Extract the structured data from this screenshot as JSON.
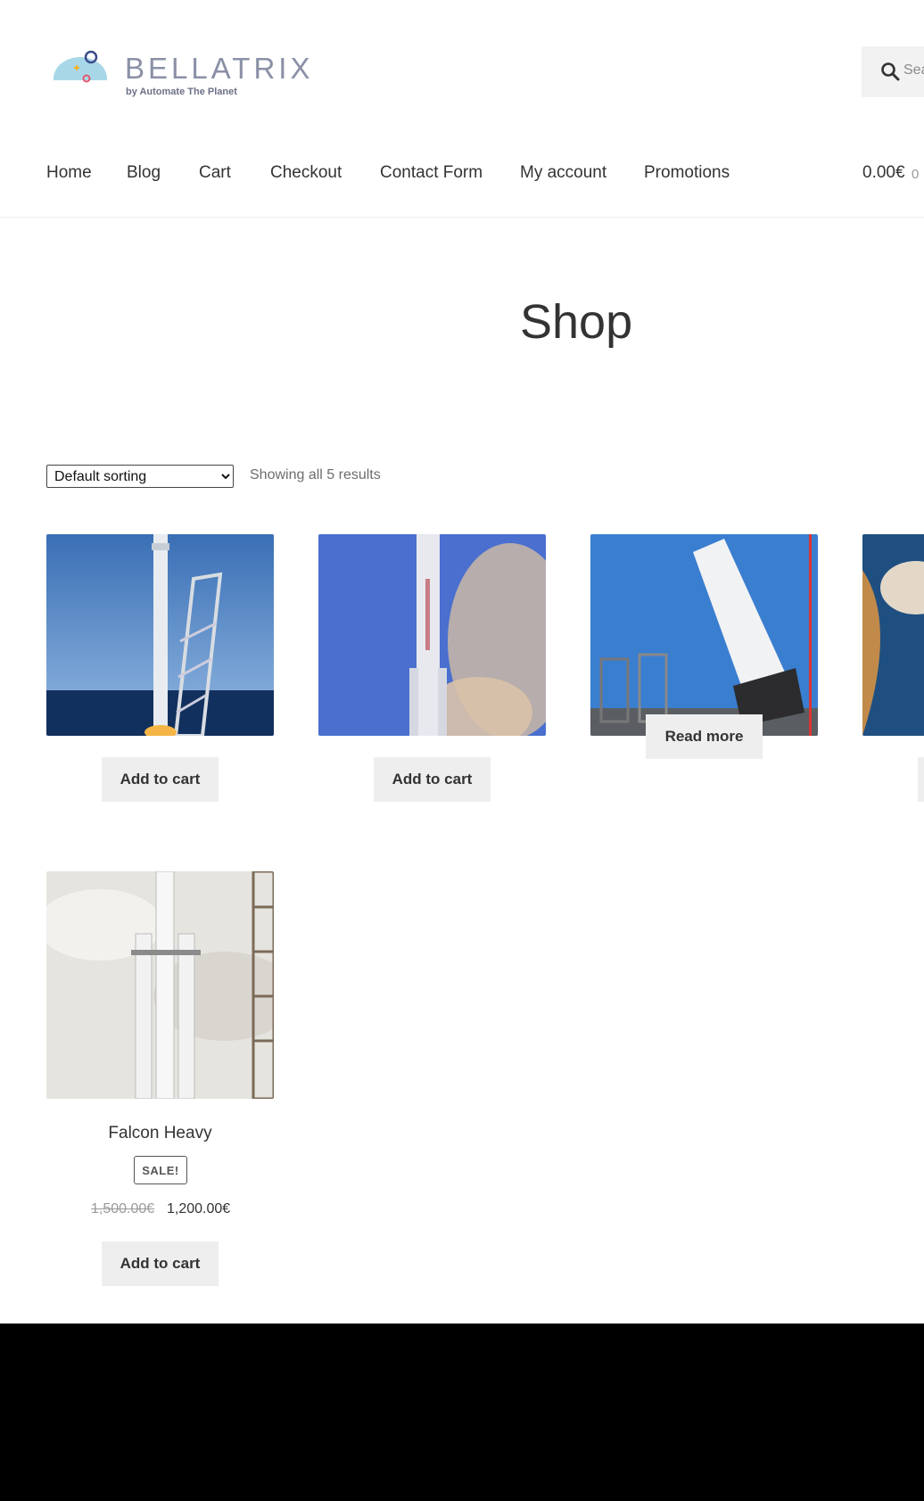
{
  "header": {
    "logo_text": "BELLATRIX",
    "logo_subtitle": "by Automate The Planet",
    "search_placeholder": "Sea"
  },
  "nav": {
    "items": [
      "Home",
      "Blog",
      "Cart",
      "Checkout",
      "Contact Form",
      "My account",
      "Promotions"
    ],
    "cart_total": "0.00€",
    "cart_count": "0"
  },
  "shop": {
    "title": "Shop",
    "sort_selected": "Default sorting",
    "result_count": "Showing all 5 results"
  },
  "products": [
    {
      "button": "Add to cart"
    },
    {
      "button": "Add to cart"
    },
    {
      "button": "Read more"
    },
    {
      "button": ""
    },
    {
      "title": "Falcon Heavy",
      "badge": "SALE!",
      "old_price": "1,500.00€",
      "price": "1,200.00€",
      "button": "Add to cart"
    }
  ],
  "colors": {
    "button_bg": "#eeeeee",
    "page_bg": "#ffffff",
    "footer_bg": "#000000"
  }
}
